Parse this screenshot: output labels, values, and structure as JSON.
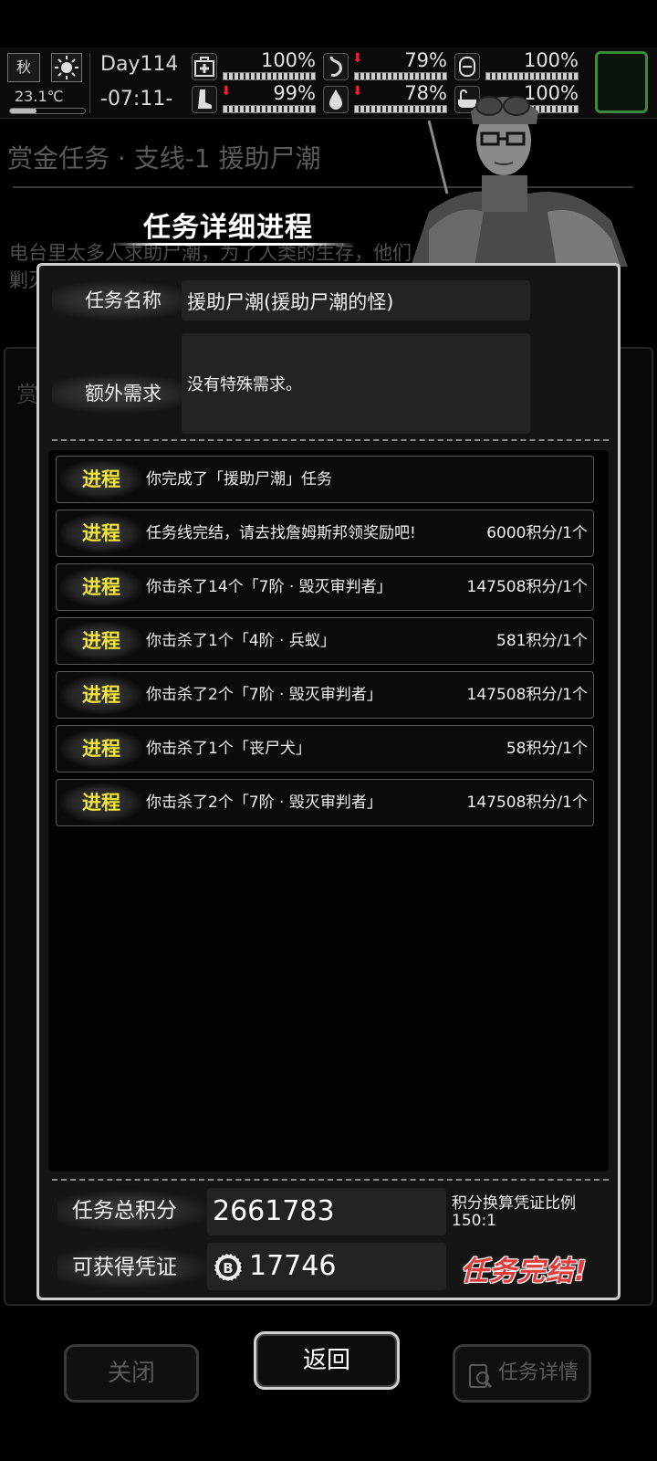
{
  "status_bar": {
    "season": "秋",
    "temperature": "23.1℃",
    "day": "Day114",
    "time": "-07:11-",
    "stats": [
      {
        "name": "health",
        "icon": "medkit-icon",
        "value": "100%",
        "trend_down": false
      },
      {
        "name": "hunger",
        "icon": "stomach-icon",
        "value": "79%",
        "trend_down": true
      },
      {
        "name": "mood",
        "icon": "mask-icon",
        "value": "100%",
        "trend_down": false
      },
      {
        "name": "stamina",
        "icon": "boot-icon",
        "value": "99%",
        "trend_down": true
      },
      {
        "name": "thirst",
        "icon": "water-drop-icon",
        "value": "78%",
        "trend_down": true
      },
      {
        "name": "hygiene",
        "icon": "bathtub-icon",
        "value": "100%",
        "trend_down": false
      }
    ]
  },
  "background": {
    "title": "赏金任务 · 支线-1 援助尸潮",
    "text_line1": "电台里太多人求助尸潮，为了人类的生存，他们",
    "text_line2": "剿灭",
    "side_char": "赏"
  },
  "dialog": {
    "title": "任务详细进程",
    "task_name_label": "任务名称",
    "task_name_value": "援助尸潮(援助尸潮的怪)",
    "extra_req_label": "额外需求",
    "extra_req_value": "没有特殊需求。",
    "progress_tag": "进程",
    "rows": [
      {
        "desc": "你完成了「援助尸潮」任务",
        "reward": ""
      },
      {
        "desc": "任务线完结，请去找詹姆斯邦领奖励吧!",
        "reward": "6000积分/1个"
      },
      {
        "desc": "你击杀了14个「7阶 · 毁灭审判者」",
        "reward": "147508积分/1个"
      },
      {
        "desc": "你击杀了1个「4阶 · 兵蚁」",
        "reward": "581积分/1个"
      },
      {
        "desc": "你击杀了2个「7阶 · 毁灭审判者」",
        "reward": "147508积分/1个"
      },
      {
        "desc": "你击杀了1个「丧尸犬」",
        "reward": "58积分/1个"
      },
      {
        "desc": "你击杀了2个「7阶 · 毁灭审判者」",
        "reward": "147508积分/1个"
      }
    ],
    "total_points_label": "任务总积分",
    "total_points_value": "2661783",
    "voucher_label": "可获得凭证",
    "voucher_value": "17746",
    "ratio_title": "积分换算凭证比例",
    "ratio_value": "150:1",
    "complete_text": "任务完结!"
  },
  "buttons": {
    "close": "关闭",
    "back": "返回",
    "details": "任务详情"
  }
}
